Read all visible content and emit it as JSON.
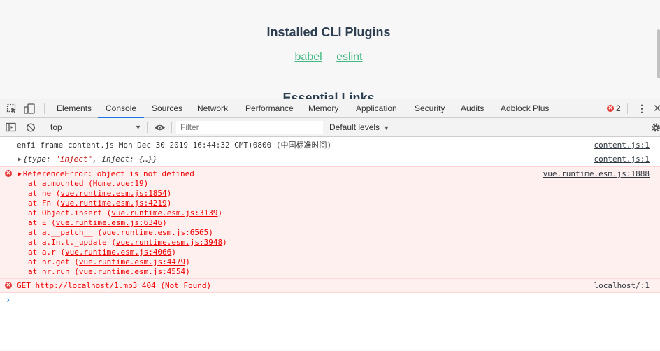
{
  "page": {
    "title": "Installed CLI Plugins",
    "plugins": [
      "babel",
      "eslint"
    ],
    "subtitle": "Essential Links"
  },
  "devtools": {
    "tabs": [
      "Elements",
      "Console",
      "Sources",
      "Network",
      "Performance",
      "Memory",
      "Application",
      "Security",
      "Audits",
      "Adblock Plus"
    ],
    "active_tab": "Console",
    "error_count": "2",
    "context": "top",
    "filter_placeholder": "Filter",
    "levels": "Default levels"
  },
  "console": {
    "line1": {
      "text": "enfi frame content.js Mon Dec 30 2019 16:44:32 GMT+0800 (中国标准时间)",
      "src": "content.js:1"
    },
    "line2": {
      "prefix": "{type: ",
      "type_val": "\"inject\"",
      "suffix": ", inject: {…}}",
      "src": "content.js:1"
    },
    "error1": {
      "message": "ReferenceError: object is not defined",
      "src": "vue.runtime.esm.js:1888",
      "stack": [
        {
          "fn": "at a.mounted (",
          "loc": "Home.vue:19",
          "end": ")"
        },
        {
          "fn": "at ne (",
          "loc": "vue.runtime.esm.js:1854",
          "end": ")"
        },
        {
          "fn": "at Fn (",
          "loc": "vue.runtime.esm.js:4219",
          "end": ")"
        },
        {
          "fn": "at Object.insert (",
          "loc": "vue.runtime.esm.js:3139",
          "end": ")"
        },
        {
          "fn": "at E (",
          "loc": "vue.runtime.esm.js:6346",
          "end": ")"
        },
        {
          "fn": "at a.__patch__ (",
          "loc": "vue.runtime.esm.js:6565",
          "end": ")"
        },
        {
          "fn": "at a.In.t._update (",
          "loc": "vue.runtime.esm.js:3948",
          "end": ")"
        },
        {
          "fn": "at a.r (",
          "loc": "vue.runtime.esm.js:4066",
          "end": ")"
        },
        {
          "fn": "at nr.get (",
          "loc": "vue.runtime.esm.js:4479",
          "end": ")"
        },
        {
          "fn": "at nr.run (",
          "loc": "vue.runtime.esm.js:4554",
          "end": ")"
        }
      ]
    },
    "error2": {
      "method": "GET",
      "url": "http://localhost/1.mp3",
      "status": "404 (Not Found)",
      "src": "localhost/:1"
    },
    "prompt": "›"
  },
  "colors": {
    "accent": "#1a73e8",
    "link": "#42b983",
    "error": "#e53935"
  },
  "icons": [
    "inspect-icon",
    "device-toggle-icon",
    "sidebar-toggle-icon",
    "clear-console-icon",
    "eye-icon",
    "settings-gear-icon",
    "kebab-menu-icon",
    "close-icon",
    "error-icon"
  ]
}
